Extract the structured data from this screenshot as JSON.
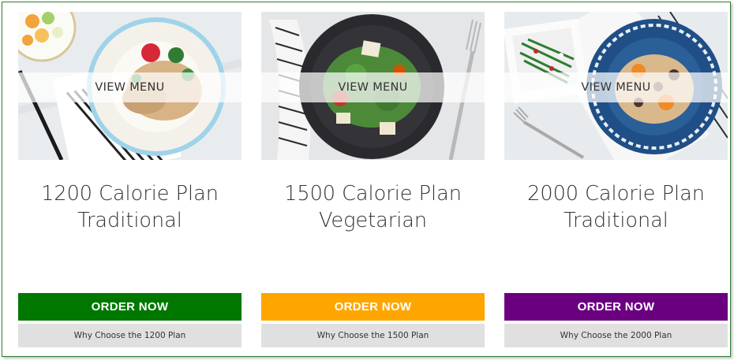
{
  "plans": [
    {
      "view_label": "VIEW MENU",
      "title_line1": "1200 Calorie Plan",
      "title_line2": "Traditional",
      "order_label": "ORDER NOW",
      "order_color": "#007800",
      "why_label": "Why Choose the 1200 Plan"
    },
    {
      "view_label": "VIEW MENU",
      "title_line1": "1500 Calorie Plan",
      "title_line2": "Vegetarian",
      "order_label": "ORDER NOW",
      "order_color": "#FFA500",
      "why_label": "Why Choose the 1500 Plan"
    },
    {
      "view_label": "VIEW MENU",
      "title_line1": "2000 Calorie Plan",
      "title_line2": "Traditional",
      "order_label": "ORDER NOW",
      "order_color": "#6A0080",
      "why_label": "Why Choose the 2000 Plan"
    }
  ]
}
